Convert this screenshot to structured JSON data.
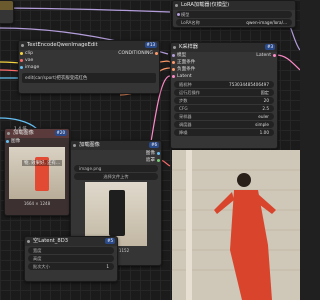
{
  "colors": {
    "canvas": "#1b1b1b",
    "node": "#353535",
    "title": "#2c2c2c",
    "widget": "#222222",
    "wire_clip": "#f5d442",
    "wire_model": "#b39ddb",
    "wire_cond": "#ff9a6b",
    "wire_latent": "#ff8ac8",
    "wire_vae": "#ff6b6b",
    "wire_image": "#66c0f4",
    "badge": "#2b4a8a"
  },
  "node_lora": {
    "title": "LoRA加载器(仅模型)",
    "widgets": [
      {
        "label": "模型"
      },
      {
        "label": "LoRA名称",
        "value": "qwen-image/lora/..."
      },
      {
        "label": "强度",
        "value": "1.00"
      }
    ]
  },
  "node_text": {
    "title": "TextEncodeQwenImageEdit",
    "badge": "#13",
    "inputs": [
      "clip",
      "vae",
      "image"
    ],
    "output": "CONDITIONING",
    "prompt": "edit(car/sport)把衣服变成红色"
  },
  "node_ksampler": {
    "title": "K采样器",
    "badge": "#3",
    "inputs": [
      "模型",
      "正面条件",
      "负面条件",
      "Latent"
    ],
    "output": "Latent",
    "widgets": [
      {
        "label": "随机种",
        "value": "753034485406497"
      },
      {
        "label": "运行后操作",
        "value": "固定"
      },
      {
        "label": "步数",
        "value": "20"
      },
      {
        "label": "CFG",
        "value": "2.5"
      },
      {
        "label": "采样器",
        "value": "euler"
      },
      {
        "label": "调度器",
        "value": "simple"
      },
      {
        "label": "降噪",
        "value": "1.00"
      }
    ]
  },
  "node_loader": {
    "title": "加载图像",
    "badge": "#20",
    "inputs": [
      "图像"
    ],
    "size_caption": "1664 × 1248"
  },
  "node_preview": {
    "title": "加载图像",
    "badge": "#6",
    "output_labels": [
      "图像",
      "遮罩"
    ],
    "image_name": "image.png",
    "upload_label": "选择文件上传",
    "size_caption": "1536 × 1152"
  },
  "node_latent": {
    "title": "空Latent_8D3",
    "badge": "#5",
    "widgets": [
      {
        "label": "宽度"
      },
      {
        "label": "高度"
      },
      {
        "label": "批次大小",
        "value": "1"
      }
    ]
  },
  "misc": {
    "left_small_label": "1.4 倍",
    "chinese_fragment": "物, 效果好, 还有..."
  }
}
